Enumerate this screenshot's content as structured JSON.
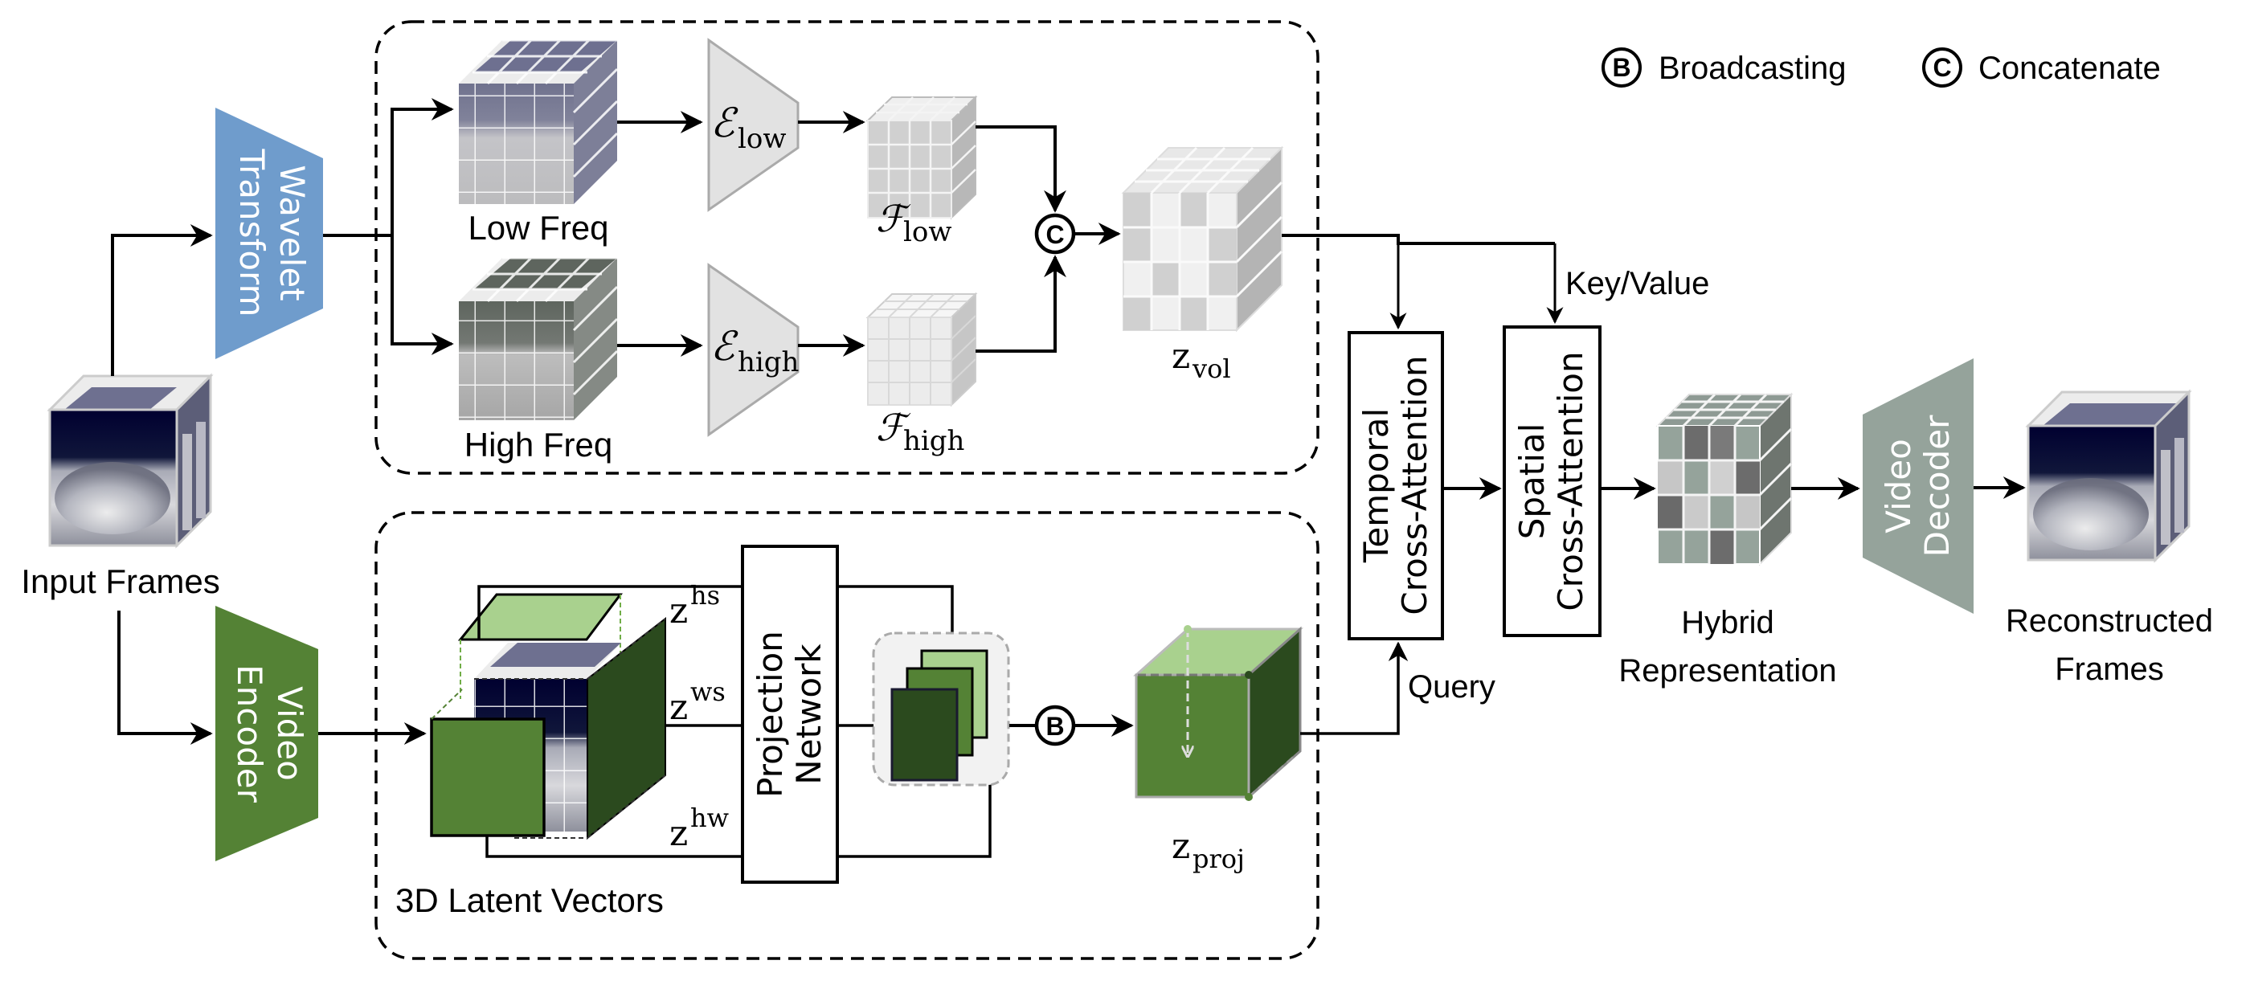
{
  "legend": {
    "broadcast_symbol": "B",
    "broadcast_label": "Broadcasting",
    "concat_symbol": "C",
    "concat_label": "Concatenate"
  },
  "blocks": {
    "wavelet_line1": "Wavelet",
    "wavelet_line2": "Transform",
    "encoder_line1": "Video",
    "encoder_line2": "Encoder",
    "decoder_line1": "Video",
    "decoder_line2": "Decoder",
    "projection_line1": "Projection",
    "projection_line2": "Network",
    "temporal_line1": "Temporal",
    "temporal_line2": "Cross-Attention",
    "spatial_line1": "Spatial",
    "spatial_line2": "Cross-Attention"
  },
  "labels": {
    "input_frames": "Input Frames",
    "low_freq": "Low Freq",
    "high_freq": "High Freq",
    "e_low_main": "ℰ",
    "e_low_sub": "low",
    "e_high_main": "ℰ",
    "e_high_sub": "high",
    "f_low_main": "ℱ",
    "f_low_sub": "low",
    "f_high_main": "ℱ",
    "f_high_sub": "high",
    "z_vol_main": "z",
    "z_vol_sub": "vol",
    "z_proj_main": "z",
    "z_proj_sub": "proj",
    "z_hs_main": "z",
    "z_hs_sup": "hs",
    "z_ws_main": "z",
    "z_ws_sup": "ws",
    "z_hw_main": "z",
    "z_hw_sup": "hw",
    "latent_vectors": "3D Latent Vectors",
    "key_value": "Key/Value",
    "query": "Query",
    "hybrid_line1": "Hybrid",
    "hybrid_line2": "Representation",
    "reconstructed_line1": "Reconstructed",
    "reconstructed_line2": "Frames"
  },
  "colors": {
    "wavelet": "#6f9ccc",
    "encoder": "#548235",
    "decoder": "#95a39b",
    "encoder_gray": "#e2e2e2",
    "green_light": "#a9d18e",
    "green_mid": "#548235",
    "green_dark": "#2b4a1e",
    "sky_dark": "#000030",
    "sky_gray": "#6e7090"
  }
}
